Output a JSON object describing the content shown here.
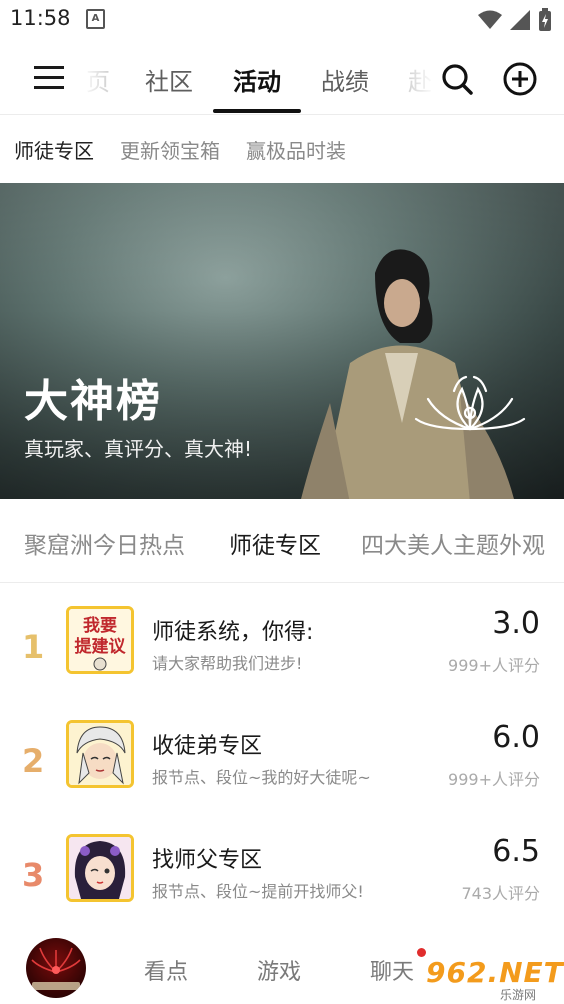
{
  "status_bar": {
    "time": "11:58",
    "notif_letter": "A"
  },
  "top_nav": {
    "tabs": [
      "页",
      "社区",
      "活动",
      "战绩",
      "赴"
    ],
    "active_tab": "活动"
  },
  "sub_tabs": [
    "师徒专区",
    "更新领宝箱",
    "赢极品时装"
  ],
  "banner": {
    "title": "大神榜",
    "subtitle": "真玩家、真评分、真大神!"
  },
  "category_tabs": [
    "聚窟洲今日热点",
    "师徒专区",
    "四大美人主题外观"
  ],
  "ranking": [
    {
      "rank": "1",
      "title": "师徒系统，你得:",
      "desc": "请大家帮助我们进步!",
      "score": "3.0",
      "count": "999+人评分",
      "thumb_text": [
        "我要",
        "提建议"
      ],
      "rank_color": "#e6c06b"
    },
    {
      "rank": "2",
      "title": "收徒弟专区",
      "desc": "报节点、段位~我的好大徒呢~",
      "score": "6.0",
      "count": "999+人评分",
      "rank_color": "#e6ae6b"
    },
    {
      "rank": "3",
      "title": "找师父专区",
      "desc": "报节点、段位~提前开找师父!",
      "score": "6.5",
      "count": "743人评分",
      "rank_color": "#e88a6a"
    }
  ],
  "bottom_nav": {
    "items": [
      "看点",
      "游戏",
      "聊天"
    ],
    "watermark": {
      "main": "962.NET",
      "sub": "乐游网"
    }
  },
  "colors": {
    "accent_gold": "#f4c430",
    "badge_red": "#e02d2d",
    "watermark_orange": "#f39b1c"
  }
}
